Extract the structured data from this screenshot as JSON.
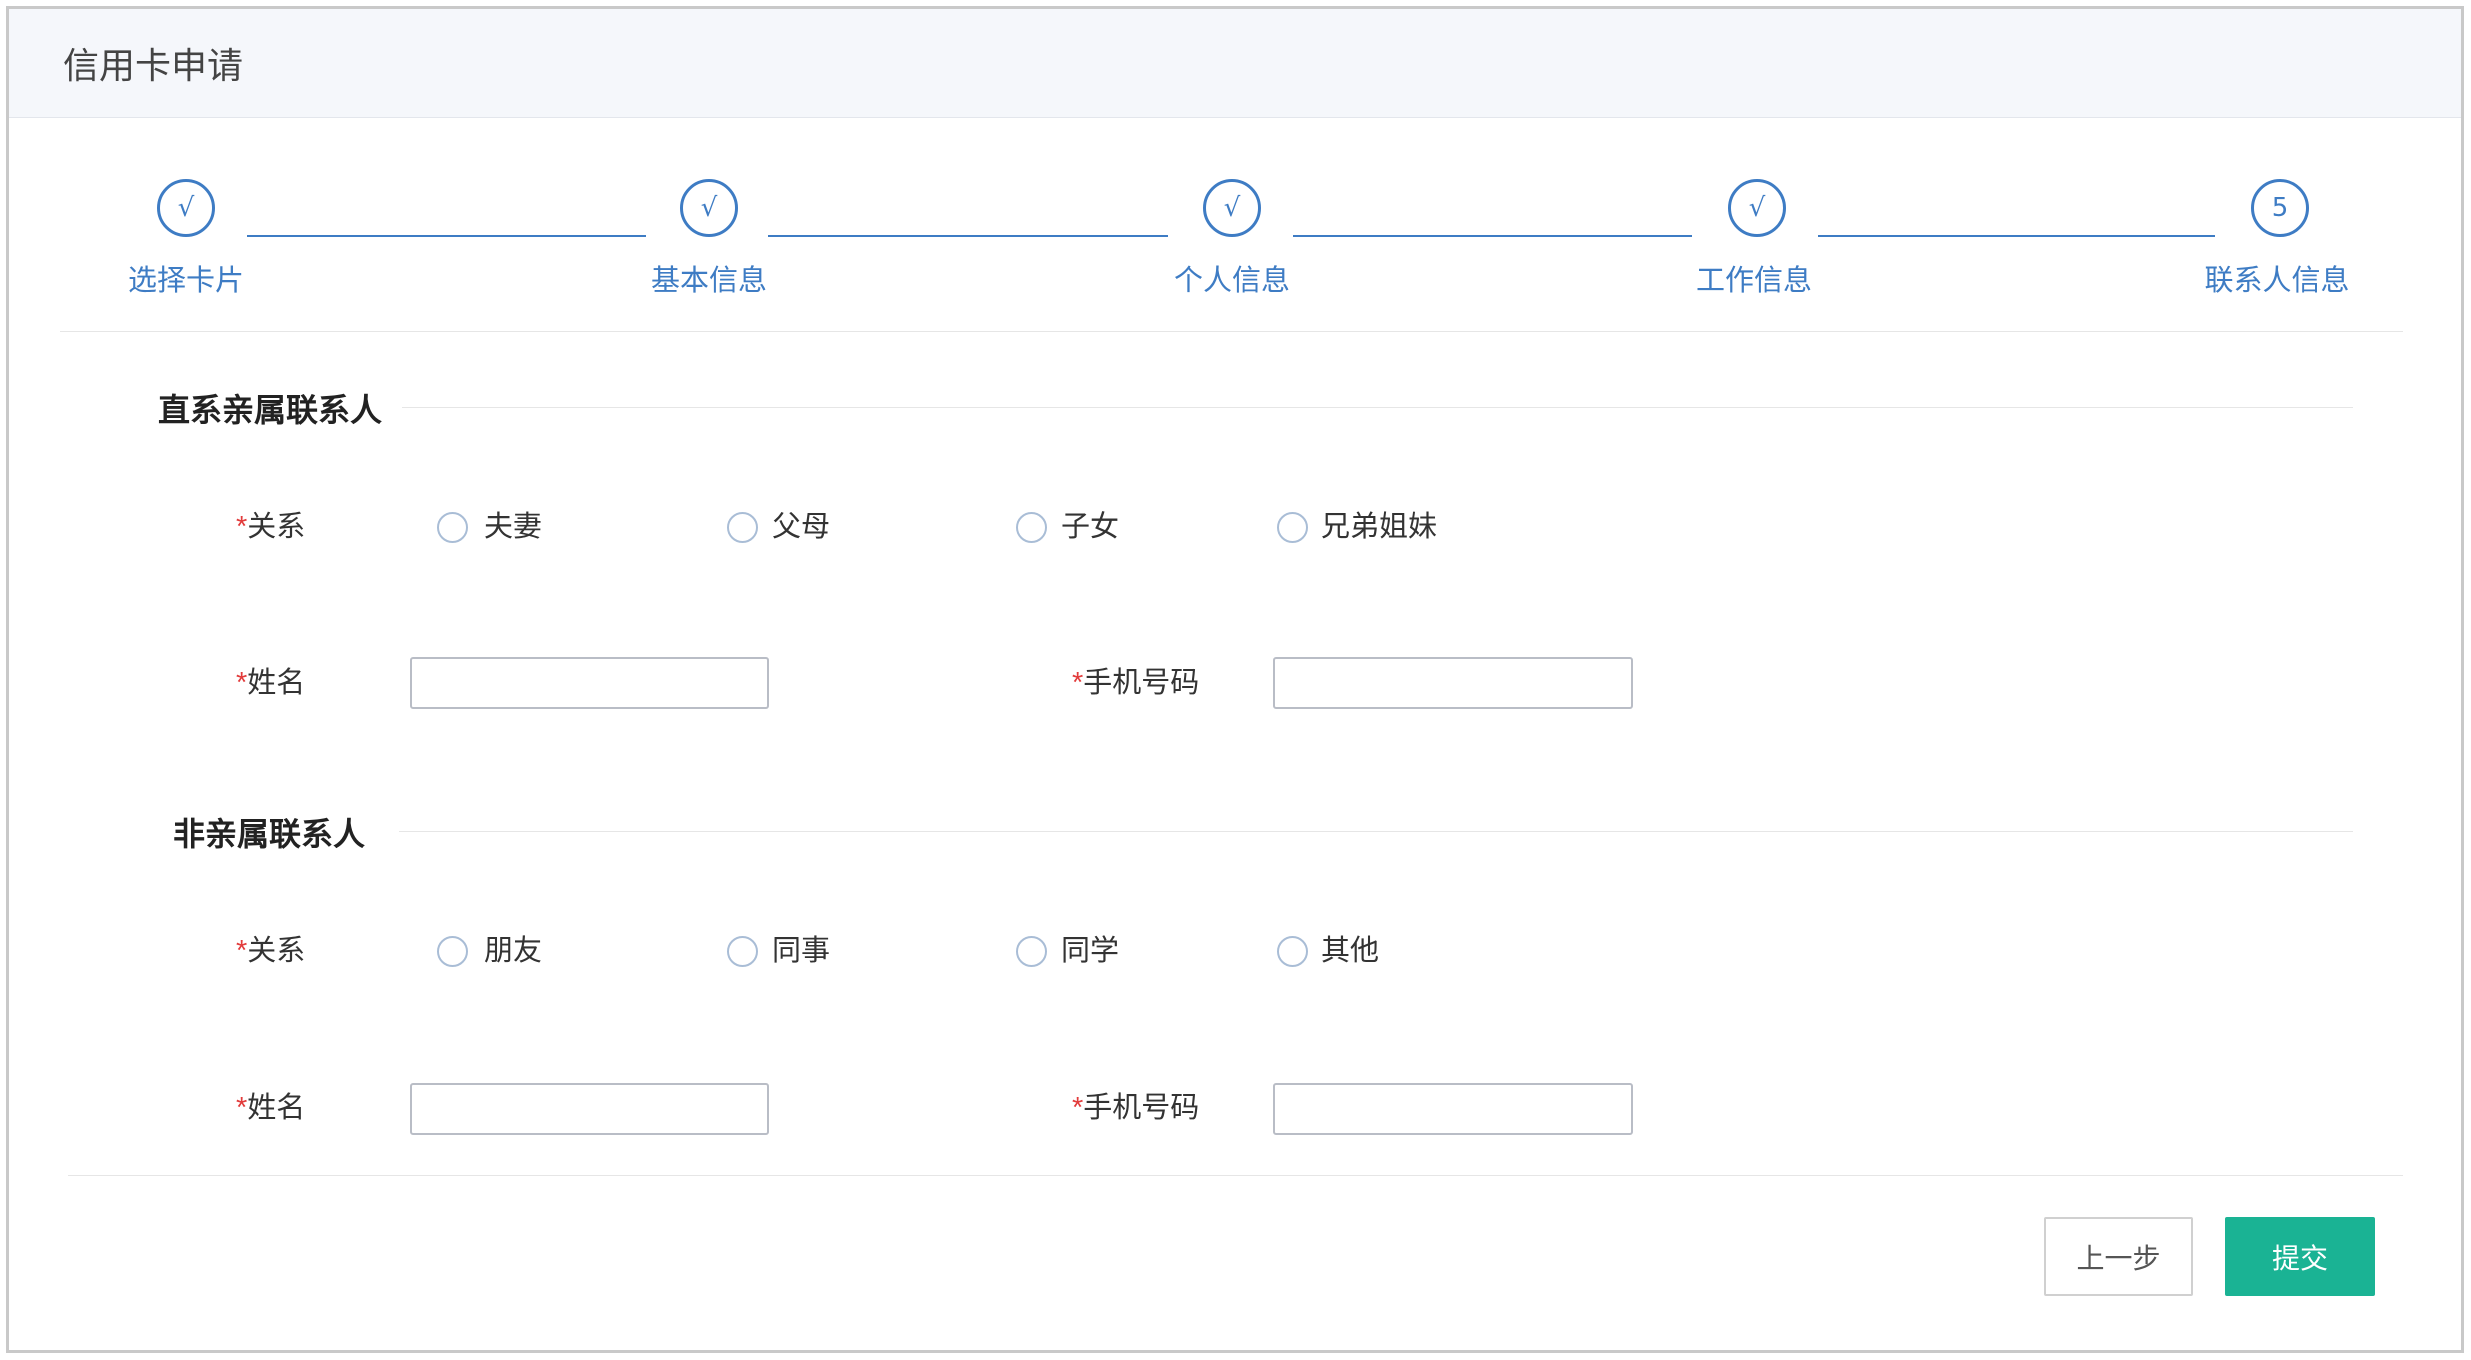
{
  "window": {
    "title": "信用卡申请"
  },
  "steps": [
    {
      "icon": "√",
      "label": "选择卡片"
    },
    {
      "icon": "√",
      "label": "基本信息"
    },
    {
      "icon": "√",
      "label": "个人信息"
    },
    {
      "icon": "√",
      "label": "工作信息"
    },
    {
      "icon": "5",
      "label": "联系人信息"
    }
  ],
  "required_mark": "*",
  "sections": [
    {
      "title": "直系亲属联系人",
      "relation_label": "关系",
      "relation_options": [
        "夫妻",
        "父母",
        "子女",
        "兄弟姐妹"
      ],
      "name_label": "姓名",
      "name_value": "",
      "phone_label": "手机号码",
      "phone_value": ""
    },
    {
      "title": "非亲属联系人",
      "relation_label": "关系",
      "relation_options": [
        "朋友",
        "同事",
        "同学",
        "其他"
      ],
      "name_label": "姓名",
      "name_value": "",
      "phone_label": "手机号码",
      "phone_value": ""
    }
  ],
  "buttons": {
    "prev": "上一步",
    "submit": "提交"
  },
  "colors": {
    "accent": "#3e7cc4",
    "submit": "#1ab394",
    "required": "#e23b3b"
  }
}
